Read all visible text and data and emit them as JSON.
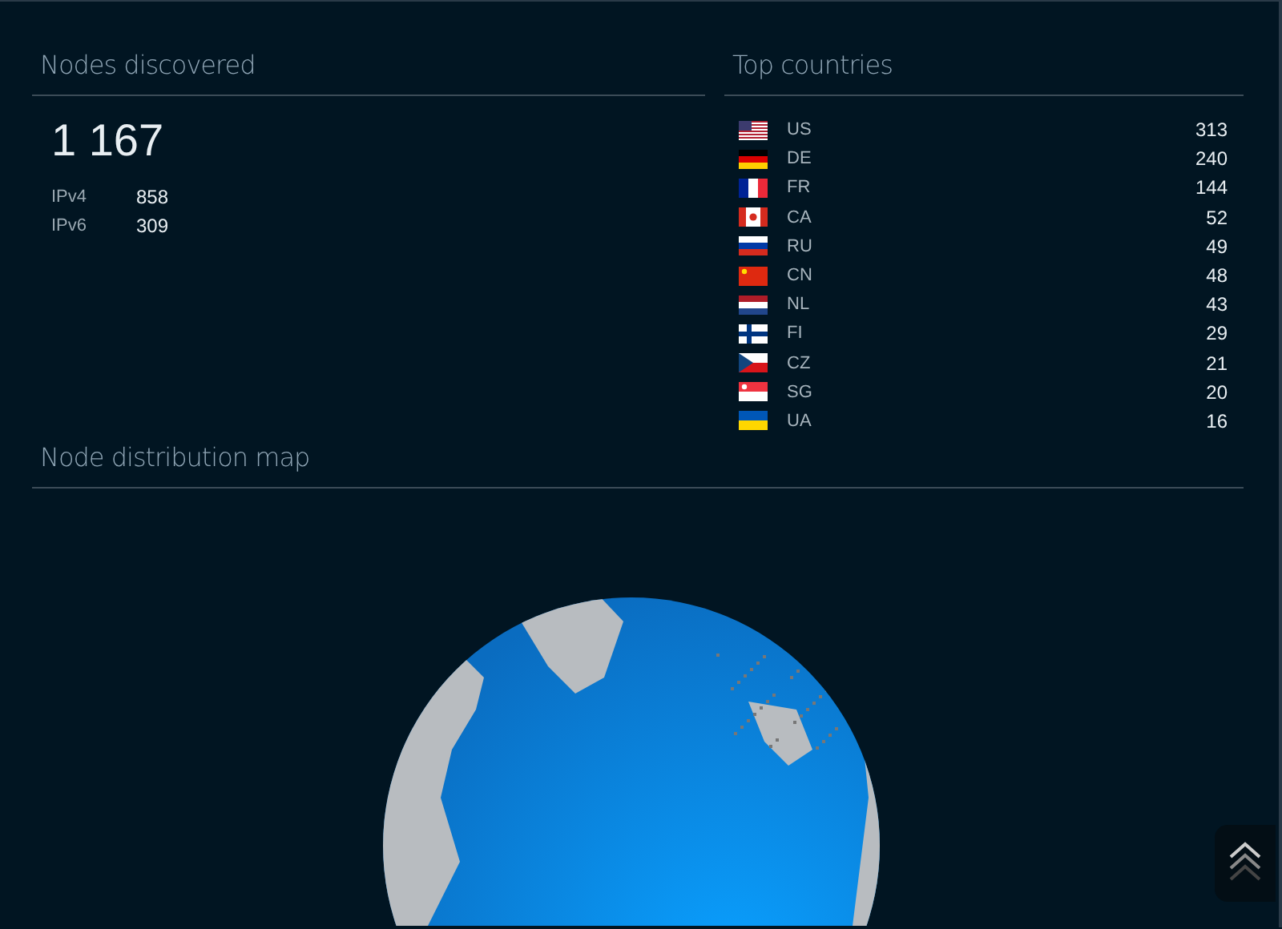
{
  "nodes": {
    "title": "Nodes discovered",
    "total": "1 167",
    "breakdown": [
      {
        "label": "IPv4",
        "value": "858"
      },
      {
        "label": "IPv6",
        "value": "309"
      }
    ]
  },
  "countries": {
    "title": "Top countries",
    "rows": [
      {
        "kind": "stars_stripes",
        "code": "US",
        "count": "313"
      },
      {
        "kind": "black_red_gold",
        "code": "DE",
        "count": "240"
      },
      {
        "kind": "vertical_tricolor",
        "code": "FR",
        "count": "144"
      },
      {
        "kind": "maple",
        "code": "CA",
        "count": "52"
      },
      {
        "kind": "white_blue_red",
        "code": "RU",
        "count": "49"
      },
      {
        "kind": "red_star",
        "code": "CN",
        "count": "48"
      },
      {
        "kind": "red_white_blue",
        "code": "NL",
        "count": "43"
      },
      {
        "kind": "nordic_cross",
        "code": "FI",
        "count": "29"
      },
      {
        "kind": "wedge",
        "code": "CZ",
        "count": "21"
      },
      {
        "kind": "red_white_crescent",
        "code": "SG",
        "count": "20"
      },
      {
        "kind": "blue_yellow",
        "code": "UA",
        "count": "16"
      }
    ]
  },
  "map": {
    "title": "Node distribution map"
  }
}
